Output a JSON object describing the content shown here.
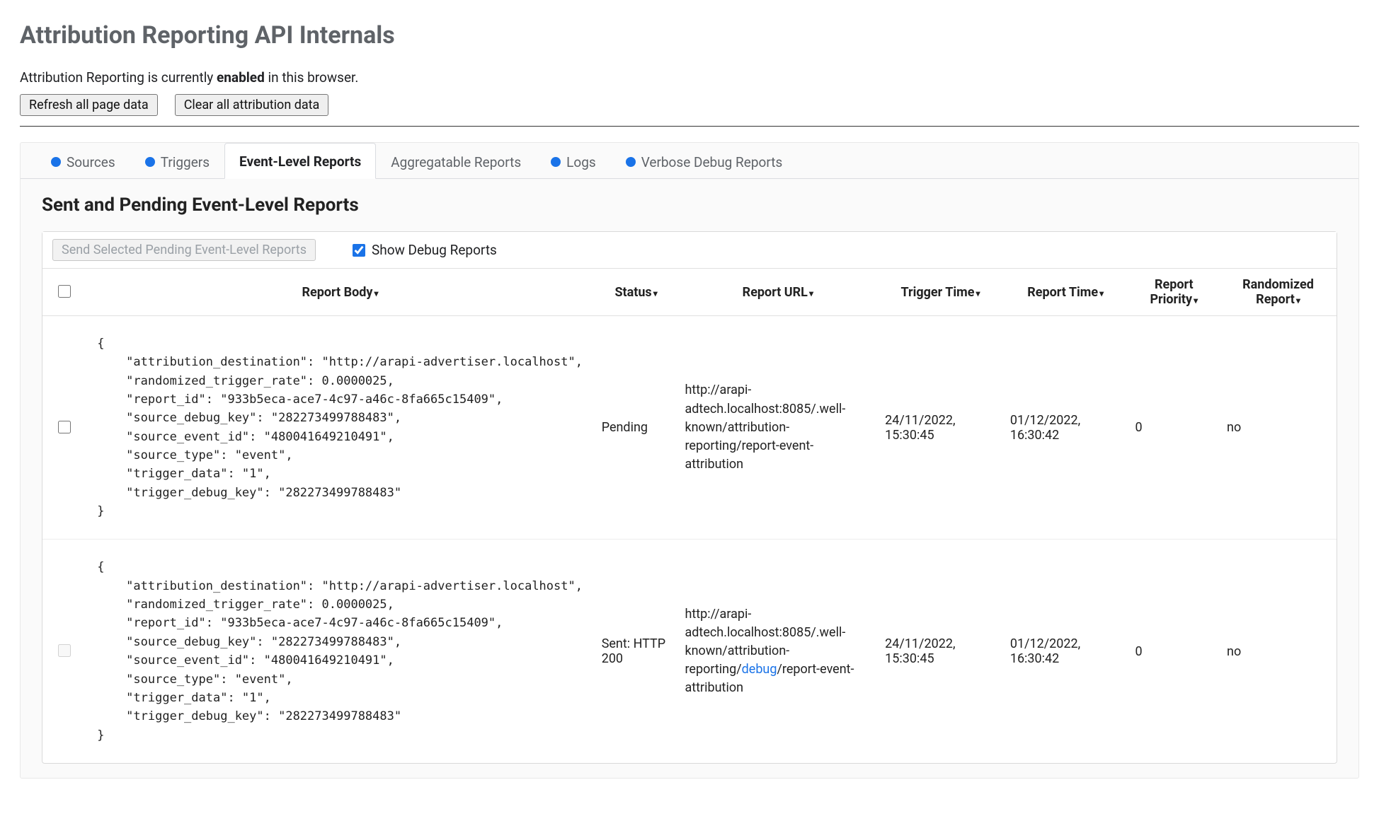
{
  "header": {
    "title": "Attribution Reporting API Internals",
    "status_prefix": "Attribution Reporting is currently ",
    "status_word": "enabled",
    "status_suffix": " in this browser.",
    "refresh_button": "Refresh all page data",
    "clear_button": "Clear all attribution data"
  },
  "tabs": [
    {
      "label": "Sources",
      "dot": true,
      "active": false
    },
    {
      "label": "Triggers",
      "dot": true,
      "active": false
    },
    {
      "label": "Event-Level Reports",
      "dot": false,
      "active": true
    },
    {
      "label": "Aggregatable Reports",
      "dot": false,
      "active": false
    },
    {
      "label": "Logs",
      "dot": true,
      "active": false
    },
    {
      "label": "Verbose Debug Reports",
      "dot": true,
      "active": false
    }
  ],
  "section_title": "Sent and Pending Event-Level Reports",
  "toolbar": {
    "send_button": "Send Selected Pending Event-Level Reports",
    "show_debug_label": "Show Debug Reports",
    "show_debug_checked": true
  },
  "columns": {
    "body": "Report Body",
    "status": "Status",
    "url": "Report URL",
    "trigger_time": "Trigger Time",
    "report_time": "Report Time",
    "priority": "Report Priority",
    "randomized": "Randomized Report"
  },
  "rows": [
    {
      "selectable": true,
      "body": "{\n    \"attribution_destination\": \"http://arapi-advertiser.localhost\",\n    \"randomized_trigger_rate\": 0.0000025,\n    \"report_id\": \"933b5eca-ace7-4c97-a46c-8fa665c15409\",\n    \"source_debug_key\": \"282273499788483\",\n    \"source_event_id\": \"480041649210491\",\n    \"source_type\": \"event\",\n    \"trigger_data\": \"1\",\n    \"trigger_debug_key\": \"282273499788483\"\n}",
      "status": "Pending",
      "url_pre": "http://arapi-adtech.localhost:8085/.well-known/attribution-reporting/",
      "url_debug": "",
      "url_post": "report-event-attribution",
      "trigger_time": "24/11/2022, 15:30:45",
      "report_time": "01/12/2022, 16:30:42",
      "priority": "0",
      "randomized": "no"
    },
    {
      "selectable": false,
      "body": "{\n    \"attribution_destination\": \"http://arapi-advertiser.localhost\",\n    \"randomized_trigger_rate\": 0.0000025,\n    \"report_id\": \"933b5eca-ace7-4c97-a46c-8fa665c15409\",\n    \"source_debug_key\": \"282273499788483\",\n    \"source_event_id\": \"480041649210491\",\n    \"source_type\": \"event\",\n    \"trigger_data\": \"1\",\n    \"trigger_debug_key\": \"282273499788483\"\n}",
      "status": "Sent: HTTP 200",
      "url_pre": "http://arapi-adtech.localhost:8085/.well-known/attribution-reporting/",
      "url_debug": "debug",
      "url_post": "/report-event-attribution",
      "trigger_time": "24/11/2022, 15:30:45",
      "report_time": "01/12/2022, 16:30:42",
      "priority": "0",
      "randomized": "no"
    }
  ]
}
